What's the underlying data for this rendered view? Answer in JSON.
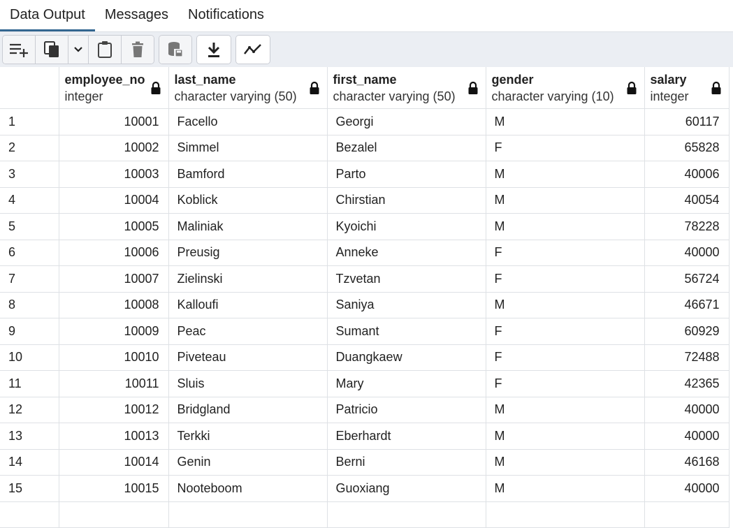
{
  "tabs": [
    "Data Output",
    "Messages",
    "Notifications"
  ],
  "toolbar": {
    "buttons": [
      "add-row-icon",
      "copy-icon",
      "chevron-down-icon",
      "paste-icon",
      "delete-icon",
      "save-data-icon",
      "download-icon",
      "graph-icon"
    ]
  },
  "columns": [
    {
      "name": "employee_no",
      "type": "integer"
    },
    {
      "name": "last_name",
      "type": "character varying (50)"
    },
    {
      "name": "first_name",
      "type": "character varying (50)"
    },
    {
      "name": "gender",
      "type": "character varying (10)"
    },
    {
      "name": "salary",
      "type": "integer"
    }
  ],
  "rows": [
    {
      "n": "1",
      "employee_no": "10001",
      "last_name": "Facello",
      "first_name": "Georgi",
      "gender": "M",
      "salary": "60117"
    },
    {
      "n": "2",
      "employee_no": "10002",
      "last_name": "Simmel",
      "first_name": "Bezalel",
      "gender": "F",
      "salary": "65828"
    },
    {
      "n": "3",
      "employee_no": "10003",
      "last_name": "Bamford",
      "first_name": "Parto",
      "gender": "M",
      "salary": "40006"
    },
    {
      "n": "4",
      "employee_no": "10004",
      "last_name": "Koblick",
      "first_name": "Chirstian",
      "gender": "M",
      "salary": "40054"
    },
    {
      "n": "5",
      "employee_no": "10005",
      "last_name": "Maliniak",
      "first_name": "Kyoichi",
      "gender": "M",
      "salary": "78228"
    },
    {
      "n": "6",
      "employee_no": "10006",
      "last_name": "Preusig",
      "first_name": "Anneke",
      "gender": "F",
      "salary": "40000"
    },
    {
      "n": "7",
      "employee_no": "10007",
      "last_name": "Zielinski",
      "first_name": "Tzvetan",
      "gender": "F",
      "salary": "56724"
    },
    {
      "n": "8",
      "employee_no": "10008",
      "last_name": "Kalloufi",
      "first_name": "Saniya",
      "gender": "M",
      "salary": "46671"
    },
    {
      "n": "9",
      "employee_no": "10009",
      "last_name": "Peac",
      "first_name": "Sumant",
      "gender": "F",
      "salary": "60929"
    },
    {
      "n": "10",
      "employee_no": "10010",
      "last_name": "Piveteau",
      "first_name": "Duangkaew",
      "gender": "F",
      "salary": "72488"
    },
    {
      "n": "11",
      "employee_no": "10011",
      "last_name": "Sluis",
      "first_name": "Mary",
      "gender": "F",
      "salary": "42365"
    },
    {
      "n": "12",
      "employee_no": "10012",
      "last_name": "Bridgland",
      "first_name": "Patricio",
      "gender": "M",
      "salary": "40000"
    },
    {
      "n": "13",
      "employee_no": "10013",
      "last_name": "Terkki",
      "first_name": "Eberhardt",
      "gender": "M",
      "salary": "40000"
    },
    {
      "n": "14",
      "employee_no": "10014",
      "last_name": "Genin",
      "first_name": "Berni",
      "gender": "M",
      "salary": "46168"
    },
    {
      "n": "15",
      "employee_no": "10015",
      "last_name": "Nooteboom",
      "first_name": "Guoxiang",
      "gender": "M",
      "salary": "40000"
    },
    {
      "n": "",
      "employee_no": "",
      "last_name": "",
      "first_name": "",
      "gender": "",
      "salary": ""
    }
  ],
  "colors": {
    "accent": "#326690",
    "toolbar_bg": "#ebeef3",
    "border": "#dee1e5"
  }
}
